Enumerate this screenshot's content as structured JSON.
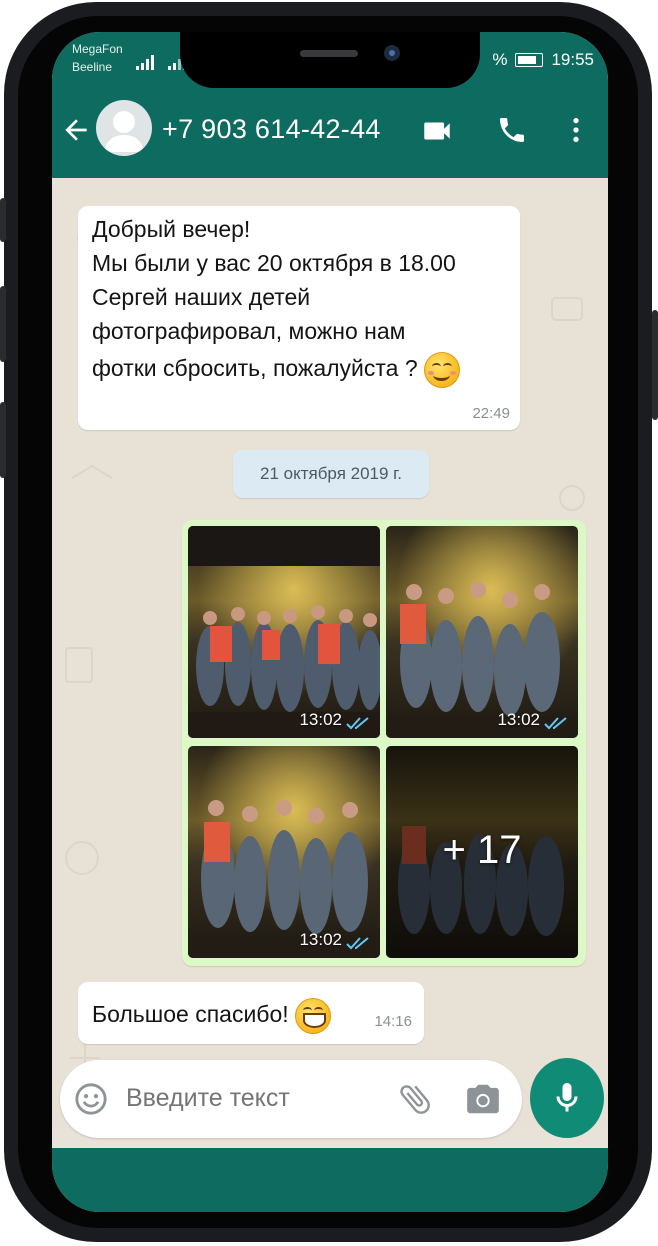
{
  "status_bar": {
    "carrier1": "MegaFon",
    "carrier2": "Beeline",
    "battery_label": "%",
    "time": "19:55"
  },
  "header": {
    "contact_name": "+7 903 614-42-44",
    "icons": [
      "back-arrow-icon",
      "avatar",
      "video-call-icon",
      "phone-icon",
      "more-vert-icon"
    ]
  },
  "messages": [
    {
      "direction": "incoming",
      "lines": [
        "Добрый вечер!",
        "Мы были у вас 20 октября в 18.00",
        "Сергей наших детей",
        "фотографировал, можно нам",
        "фотки сбросить, пожалуйста ?"
      ],
      "time": "22:49",
      "emoji": "smiling-face"
    },
    {
      "type": "date",
      "text": "21 октября 2019 г."
    },
    {
      "direction": "outgoing",
      "type": "photo-album",
      "photos": [
        {
          "time": "13:02",
          "ticks": "read"
        },
        {
          "time": "13:02",
          "ticks": "read"
        },
        {
          "time": "13:02",
          "ticks": "read"
        },
        {
          "overlay": "+ 17"
        }
      ]
    },
    {
      "direction": "incoming",
      "text": "Большое спасибо!",
      "time": "14:16",
      "emoji": "grinning-face"
    }
  ],
  "composer": {
    "placeholder": "Введите текст",
    "icons": [
      "emoji-icon",
      "attach-icon",
      "camera-icon",
      "mic-icon"
    ]
  },
  "colors": {
    "primary": "#0d6c5f",
    "accent": "#0f8b76",
    "outgoing_bubble": "#dcf8c6",
    "incoming_bubble": "#ffffff",
    "chat_bg": "#e8e1d6",
    "read_ticks": "#34b7f1"
  }
}
